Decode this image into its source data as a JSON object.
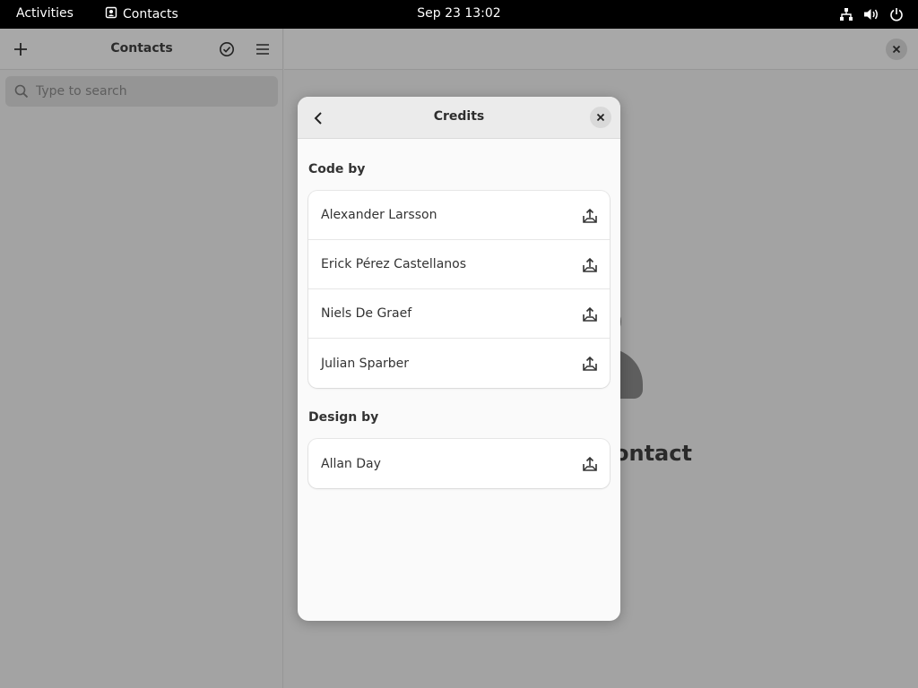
{
  "topbar": {
    "activities": "Activities",
    "app_name": "Contacts",
    "clock": "Sep 23  13:02",
    "icons": [
      "network-icon",
      "volume-icon",
      "power-icon"
    ]
  },
  "sidebar": {
    "title": "Contacts",
    "search_placeholder": "Type to search"
  },
  "main": {
    "placeholder_title": "ontact"
  },
  "dialog": {
    "title": "Credits",
    "sections": [
      {
        "title": "Code by",
        "people": [
          "Alexander Larsson",
          "Erick Pérez Castellanos",
          "Niels De Graef",
          "Julian Sparber"
        ]
      },
      {
        "title": "Design by",
        "people": [
          "Allan Day"
        ]
      }
    ]
  }
}
